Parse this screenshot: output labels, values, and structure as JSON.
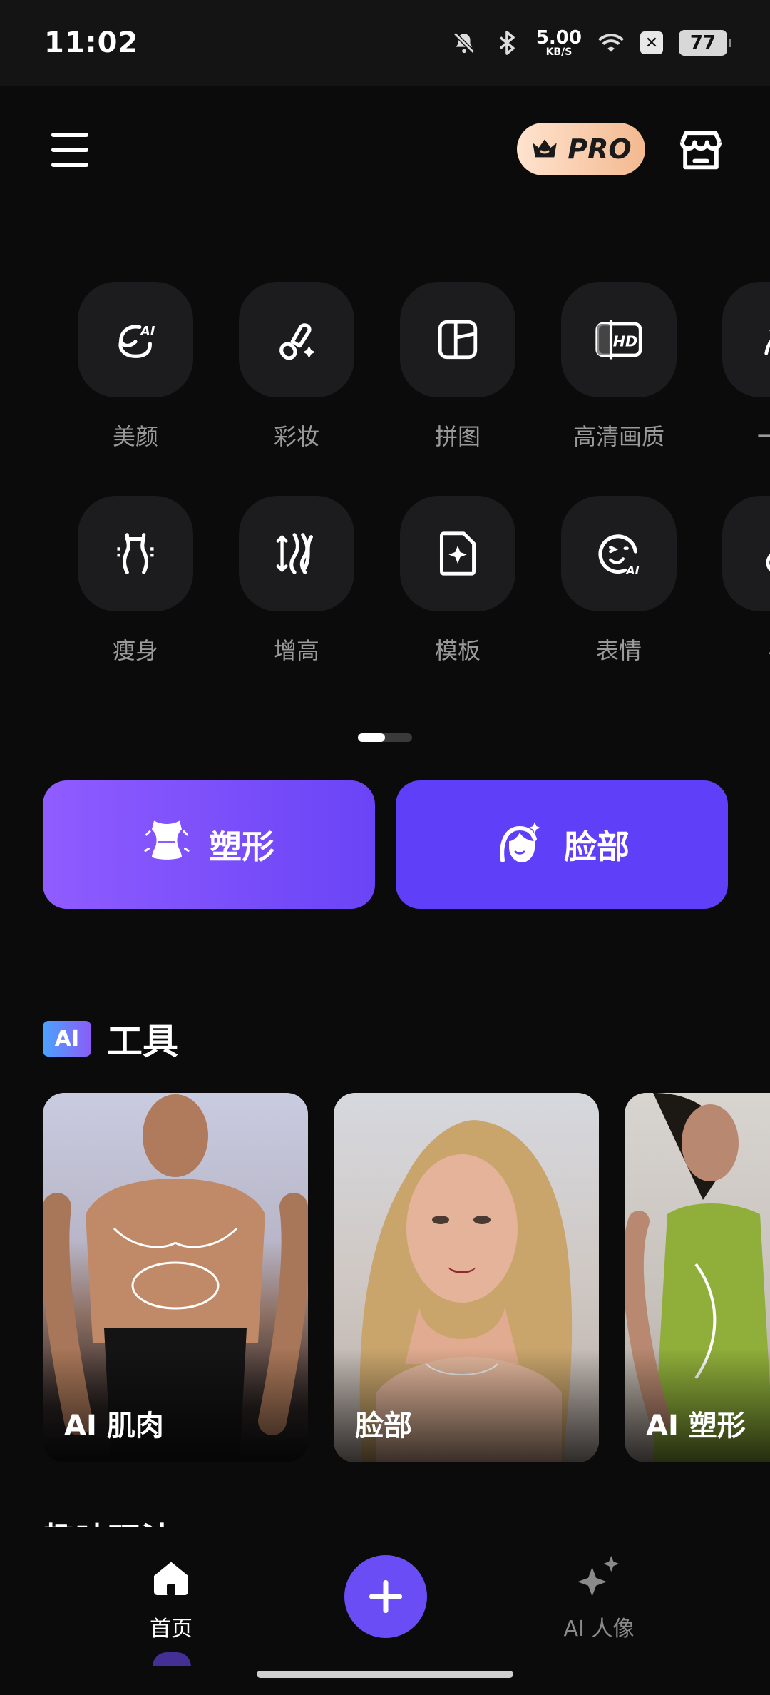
{
  "status_bar": {
    "time": "11:02",
    "net_speed_value": "5.00",
    "net_speed_unit": "KB/S",
    "battery": "77",
    "icons": [
      "mute-bell-icon",
      "bluetooth-icon",
      "wifi-icon",
      "x-app-icon",
      "battery-icon"
    ]
  },
  "header": {
    "pro_label": "PRO",
    "icons": [
      "menu-icon",
      "crown-icon",
      "store-icon"
    ]
  },
  "tools_row1": [
    {
      "label": "美颜",
      "icon": "ai-face-icon"
    },
    {
      "label": "彩妆",
      "icon": "makeup-brush-icon"
    },
    {
      "label": "拼图",
      "icon": "collage-icon"
    },
    {
      "label": "高清画质",
      "icon": "hd-icon"
    },
    {
      "label": "一键",
      "icon": "one-tap-icon"
    }
  ],
  "tools_row2": [
    {
      "label": "瘦身",
      "icon": "slim-body-icon"
    },
    {
      "label": "增高",
      "icon": "height-icon"
    },
    {
      "label": "模板",
      "icon": "template-icon"
    },
    {
      "label": "表情",
      "icon": "ai-expression-icon"
    },
    {
      "label": "AI",
      "icon": "ai-tool-icon"
    }
  ],
  "pager": {
    "current": 1,
    "total": 2
  },
  "big_buttons": {
    "shape": {
      "label": "塑形",
      "icon": "body-shape-icon"
    },
    "face": {
      "label": "脸部",
      "icon": "face-icon"
    }
  },
  "ai_section": {
    "badge": "AI",
    "title": "工具",
    "cards": [
      {
        "label": "AI 肌肉"
      },
      {
        "label": "脸部"
      },
      {
        "label": "AI 塑形"
      }
    ]
  },
  "peek_section_title": "趣味玩法",
  "bottom_nav": {
    "home_label": "首页",
    "ai_portrait_label": "AI 人像",
    "icons": [
      "home-icon",
      "plus-icon",
      "sparkle-icon"
    ]
  },
  "colors": {
    "background": "#0b0b0b",
    "tile": "#1c1c1e",
    "accent_purple": "#6a4df5",
    "pro_gradient_start": "#ffe3cf",
    "pro_gradient_end": "#f3b98f"
  }
}
